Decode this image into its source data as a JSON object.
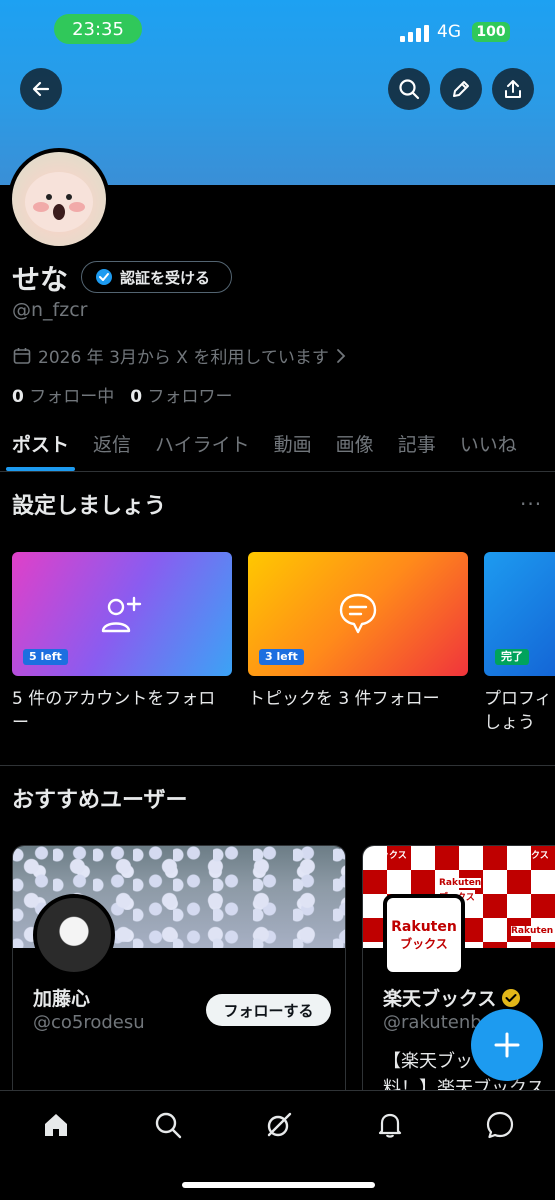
{
  "status_bar": {
    "time": "23:35",
    "network": "4G",
    "battery": "100"
  },
  "profile": {
    "display_name": "せな",
    "verify_label": "認証を受ける",
    "handle": "@n_fzcr",
    "joined": "2026 年 3月から X を利用しています",
    "following_count": "0",
    "following_label": "フォロー中",
    "followers_count": "0",
    "followers_label": "フォロワー"
  },
  "tabs": [
    "ポスト",
    "返信",
    "ハイライト",
    "動画",
    "画像",
    "記事",
    "いいね"
  ],
  "setup": {
    "title": "設定しましょう",
    "cards": [
      {
        "badge": "5 left",
        "caption_line1": "5 件のアカウントをフォロ",
        "caption_line2": "ー",
        "icon": "add-user-icon"
      },
      {
        "badge": "3 left",
        "caption_line1": "トピックを 3 件フォロー",
        "caption_line2": "",
        "icon": "topic-icon"
      },
      {
        "badge": "完了",
        "caption_line1": "プロフィ",
        "caption_line2": "しょう",
        "icon": "profile-icon"
      }
    ]
  },
  "recommended": {
    "title": "おすすめユーザー",
    "users": [
      {
        "name": "加藤心",
        "handle": "@co5rodesu",
        "follow_label": "フォローする",
        "bio": ""
      },
      {
        "name": "楽天ブックス",
        "handle": "@rakutenb",
        "follow_label": "",
        "bio_line1": "【楽天ブッ",
        "bio_line2": "料！】楽天ブックス",
        "logo_text1": "Rakuten",
        "logo_text2": "ブックス"
      }
    ]
  },
  "banner_pattern": {
    "top_left": "ブックス",
    "mid": "Rakuten",
    "mid2": "ブックス"
  },
  "colors": {
    "accent": "#1d9bf0",
    "background": "#000000",
    "muted": "#71767b",
    "status_green": "#30c85a",
    "rakuten_red": "#bf0000"
  },
  "nav": [
    "home-icon",
    "search-icon",
    "grok-icon",
    "notifications-icon",
    "messages-icon"
  ]
}
